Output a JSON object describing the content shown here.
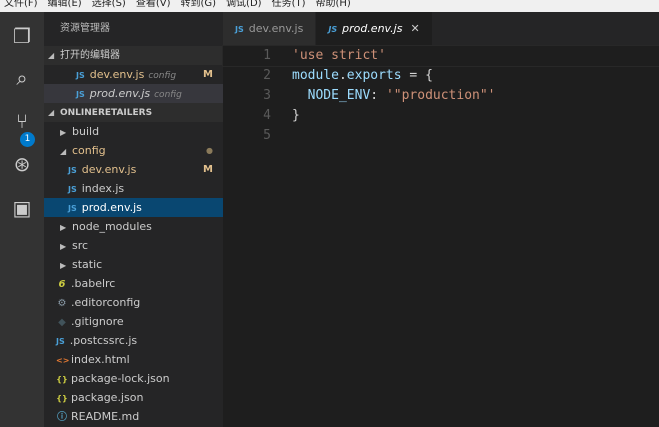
{
  "menu": [
    "文件(F)",
    "编辑(E)",
    "选择(S)",
    "查看(V)",
    "转到(G)",
    "调试(D)",
    "任务(T)",
    "帮助(H)"
  ],
  "activity": {
    "scm_badge": "1"
  },
  "sidebar": {
    "title": "资源管理器",
    "open_editors": {
      "label": "打开的编辑器",
      "items": [
        {
          "name": "dev.env.js",
          "desc": "config",
          "status": "M"
        },
        {
          "name": "prod.env.js",
          "desc": "config"
        }
      ]
    },
    "project": {
      "label": "ONLINERETAILERS"
    },
    "tree": [
      {
        "name": "build",
        "type": "folder"
      },
      {
        "name": "config",
        "type": "folder-open",
        "status": "●"
      },
      {
        "name": "dev.env.js",
        "type": "js",
        "status": "M"
      },
      {
        "name": "index.js",
        "type": "js"
      },
      {
        "name": "prod.env.js",
        "type": "js"
      },
      {
        "name": "node_modules",
        "type": "folder"
      },
      {
        "name": "src",
        "type": "folder"
      },
      {
        "name": "static",
        "type": "folder"
      },
      {
        "name": ".babelrc",
        "type": "babel"
      },
      {
        "name": ".editorconfig",
        "type": "gear"
      },
      {
        "name": ".gitignore",
        "type": "git"
      },
      {
        "name": ".postcssrc.js",
        "type": "js"
      },
      {
        "name": "index.html",
        "type": "html"
      },
      {
        "name": "package-lock.json",
        "type": "json"
      },
      {
        "name": "package.json",
        "type": "json"
      },
      {
        "name": "README.md",
        "type": "info"
      }
    ]
  },
  "tabs": [
    {
      "name": "dev.env.js"
    },
    {
      "name": "prod.env.js",
      "close": "✕"
    }
  ],
  "js_icon": "JS",
  "editor": {
    "lines": [
      {
        "n": "1",
        "parts": [
          [
            "str",
            "'use strict'"
          ]
        ]
      },
      {
        "n": "2",
        "parts": [
          [
            "id",
            "module"
          ],
          [
            "p",
            "."
          ],
          [
            "id",
            "exports"
          ],
          [
            "p",
            " = {"
          ]
        ]
      },
      {
        "n": "3",
        "parts": [
          [
            "p",
            "  "
          ],
          [
            "id",
            "NODE_ENV"
          ],
          [
            "p",
            ": "
          ],
          [
            "str",
            "'\"production\"'"
          ]
        ]
      },
      {
        "n": "4",
        "parts": [
          [
            "p",
            "}"
          ]
        ]
      },
      {
        "n": "5",
        "parts": []
      }
    ]
  }
}
